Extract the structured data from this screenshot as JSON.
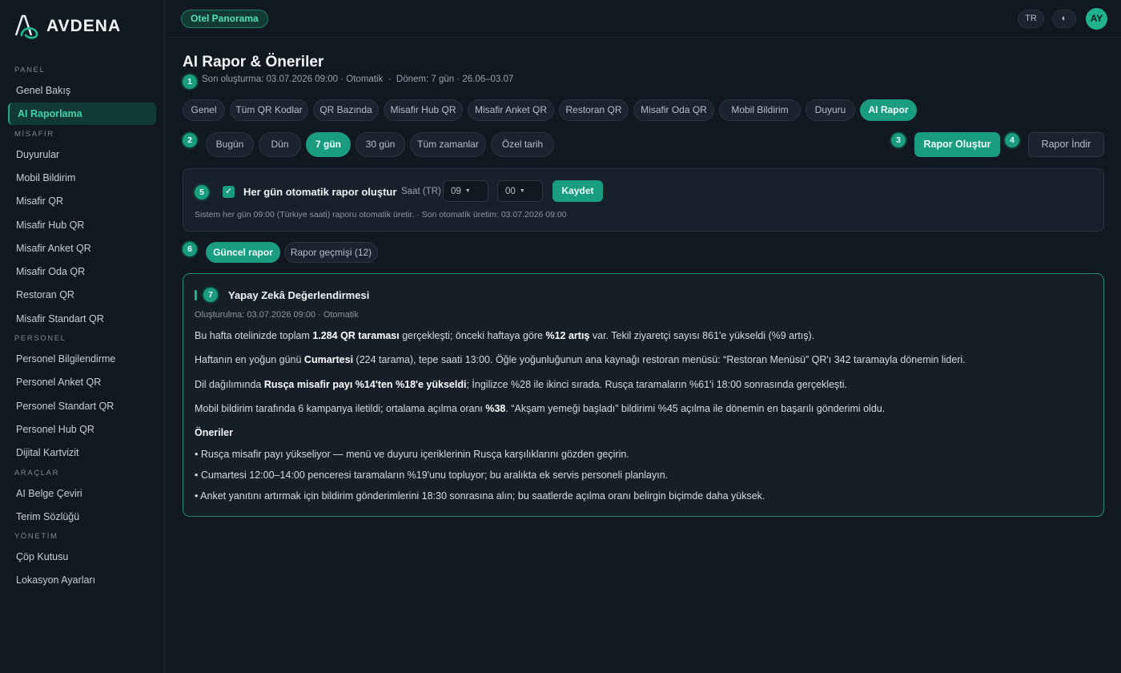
{
  "brand": {
    "name": "AVDENA"
  },
  "sidebar": {
    "sections": [
      {
        "title": "PANEL",
        "items": [
          "Genel Bakış",
          "AI Raporlama"
        ]
      },
      {
        "title": "MİSAFİR",
        "items": [
          "Duyurular",
          "Mobil Bildirim",
          "Misafir QR",
          "Misafir Hub QR",
          "Misafir Anket QR",
          "Misafir Oda QR",
          "Restoran QR",
          "Misafir Standart QR"
        ]
      },
      {
        "title": "PERSONEL",
        "items": [
          "Personel Bilgilendirme",
          "Personel Anket QR",
          "Personel Standart QR",
          "Personel Hub QR",
          "Dijital Kartvizit"
        ]
      },
      {
        "title": "ARAÇLAR",
        "items": [
          "AI Belge Çeviri",
          "Terim Sözlüğü"
        ]
      },
      {
        "title": "YÖNETİM",
        "items": [
          "Çöp Kutusu",
          "Lokasyon Ayarları"
        ]
      }
    ],
    "active": "AI Raporlama"
  },
  "topbar": {
    "location": "Otel Panorama",
    "lang": "TR",
    "theme_icon": "◐",
    "avatar": "AY"
  },
  "page": {
    "title": "AI Rapor & Öneriler",
    "meta": "Son oluşturma: 03.07.2026 09:00 · Otomatik  ·  Dönem: 7 gün · 26.06–03.07",
    "badges": [
      "1",
      "2",
      "3",
      "4",
      "5",
      "6",
      "7"
    ]
  },
  "tabs": [
    "Genel",
    "Tüm QR Kodlar",
    "QR Bazında",
    "Misafir Hub QR",
    "Misafir Anket QR",
    "Restoran QR",
    "Misafir Oda QR",
    "Mobil Bildirim",
    "Duyuru",
    "AI Rapor"
  ],
  "active_tab": "AI Rapor",
  "ranges": [
    "Bugün",
    "Dün",
    "7 gün",
    "30 gün",
    "Tüm zamanlar",
    "Özel tarih"
  ],
  "active_range": "7 gün",
  "actions": {
    "generate": "Rapor Oluştur",
    "download": "Rapor İndir"
  },
  "auto": {
    "checked": true,
    "check_glyph": "✓",
    "label": "Her gün otomatik rapor oluştur",
    "time_label": "Saat (TR)",
    "hour": "09",
    "minute": "00",
    "save": "Kaydet",
    "note": "Sistem her gün 09:00 (Türkiye saati) raporu otomatik üretir. · Son otomatik üretim: 03.07.2026 09:00"
  },
  "subtabs": [
    "Güncel rapor",
    "Rapor geçmişi (12)"
  ],
  "active_subtab": "Güncel rapor",
  "report": {
    "title": "Yapay Zekâ Değerlendirmesi",
    "meta": "Oluşturulma: 03.07.2026 09:00 · Otomatik",
    "paragraphs": [
      [
        [
          "Bu hafta otelinizde toplam ",
          false
        ],
        [
          "1.284 QR taraması",
          true
        ],
        [
          " gerçekleşti; önceki haftaya göre ",
          false
        ],
        [
          "%12 artış",
          true
        ],
        [
          " var. Tekil ziyaretçi sayısı 861'e yükseldi (%9 artış).",
          false
        ]
      ],
      [
        [
          "Haftanın en yoğun günü ",
          false
        ],
        [
          "Cumartesi",
          true
        ],
        [
          " (224 tarama), tepe saati 13:00. Öğle yoğunluğunun ana kaynağı restoran menüsü: “Restoran Menüsü” QR'ı 342 taramayla dönemin lideri.",
          false
        ]
      ],
      [
        [
          "Dil dağılımında ",
          false
        ],
        [
          "Rusça misafir payı %14'ten %18'e yükseldi",
          true
        ],
        [
          "; İngilizce %28 ile ikinci sırada. Rusça taramaların %61'i 18:00 sonrasında gerçekleşti.",
          false
        ]
      ],
      [
        [
          "Mobil bildirim tarafında 6 kampanya iletildi; ortalama açılma oranı ",
          false
        ],
        [
          "%38",
          true
        ],
        [
          ". “Akşam yemeği başladı” bildirimi %45 açılma ile dönemin en başarılı gönderimi oldu.",
          false
        ]
      ]
    ],
    "recommendations_title": "Öneriler",
    "recommendations": [
      "• Rusça misafir payı yükseliyor — menü ve duyuru içeriklerinin Rusça karşılıklarını gözden geçirin.",
      "• Cumartesi 12:00–14:00 penceresi taramaların %19'unu topluyor; bu aralıkta ek servis personeli planlayın.",
      "• Anket yanıtını artırmak için bildirim gönderimlerini 18:30 sonrasına alın; bu saatlerde açılma oranı belirgin biçimde daha yüksek."
    ]
  },
  "colors": {
    "accent": "#1a9c81",
    "accent_text": "#3fd1b0",
    "bg": "#111821",
    "card": "#18212b"
  }
}
